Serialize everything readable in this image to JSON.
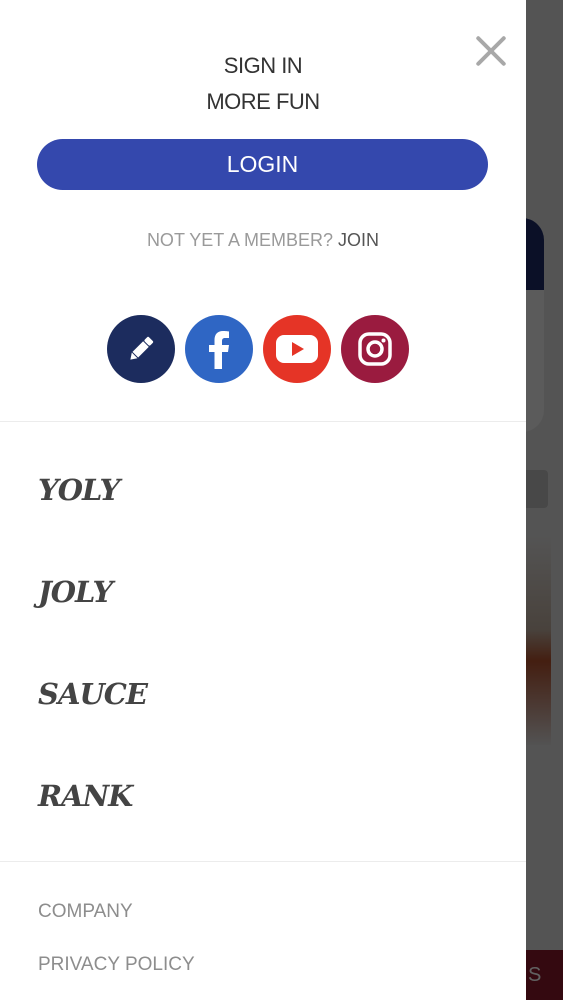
{
  "drawer": {
    "signin_line1": "SIGN IN",
    "signin_line2": "MORE FUN",
    "login_label": "LOGIN",
    "member_prompt": "NOT YET A MEMBER?",
    "join_label": "JOIN",
    "close_icon": "close-icon"
  },
  "socials": [
    {
      "name": "pencil-icon",
      "color": "#1c2c5e"
    },
    {
      "name": "facebook-icon",
      "color": "#2f66c4"
    },
    {
      "name": "youtube-icon",
      "color": "#e53426"
    },
    {
      "name": "instagram-icon",
      "color": "#9a1b3f"
    }
  ],
  "menu": {
    "items": [
      {
        "label": "YOLY"
      },
      {
        "label": "JOLY"
      },
      {
        "label": "SAUCE"
      },
      {
        "label": "RANK"
      }
    ]
  },
  "footer": {
    "links": [
      {
        "label": "COMPANY"
      },
      {
        "label": "PRIVACY POLICY"
      }
    ]
  },
  "background": {
    "button_fragment": "S"
  },
  "colors": {
    "login_button": "#3448ad",
    "overlay": "#000000"
  }
}
